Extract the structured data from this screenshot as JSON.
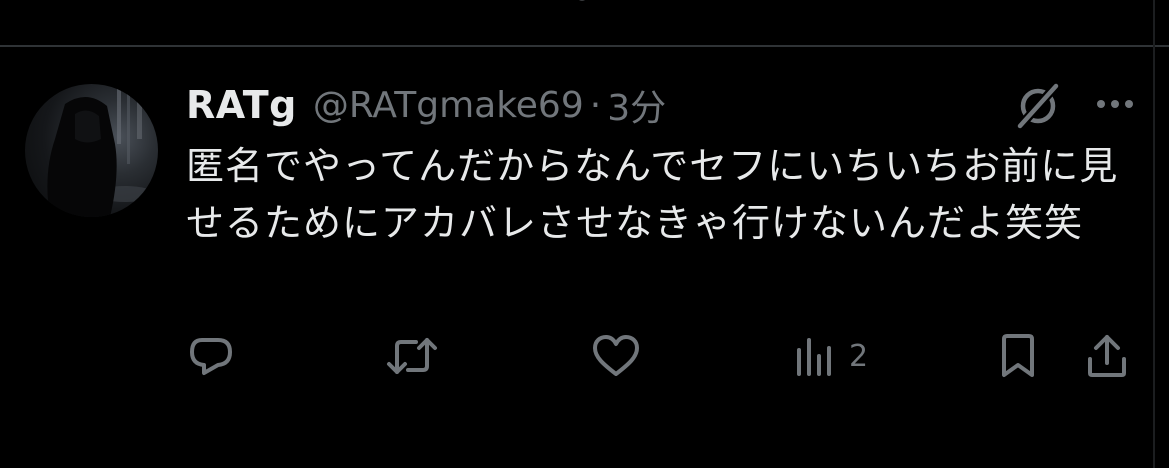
{
  "tweet": {
    "display_name": "RATg",
    "handle": "@RATgmake69",
    "separator": "·",
    "time": "3分",
    "text": "匿名でやってんだからなんでセフにいちいちお前に見せるためにアカバレさせなきゃ行けないんだよ笑笑"
  },
  "actions": {
    "views_count": "2"
  },
  "icons": {
    "avatar": "avatar-photo",
    "grok": "grok-icon",
    "more": "more-icon",
    "reply": "reply-icon",
    "retweet": "retweet-icon",
    "like": "heart-icon",
    "views": "views-icon",
    "bookmark": "bookmark-icon",
    "share": "share-icon"
  },
  "colors": {
    "background": "#000000",
    "primary_text": "#e7e9ea",
    "secondary_text": "#71767b",
    "divider": "#2f3336"
  }
}
